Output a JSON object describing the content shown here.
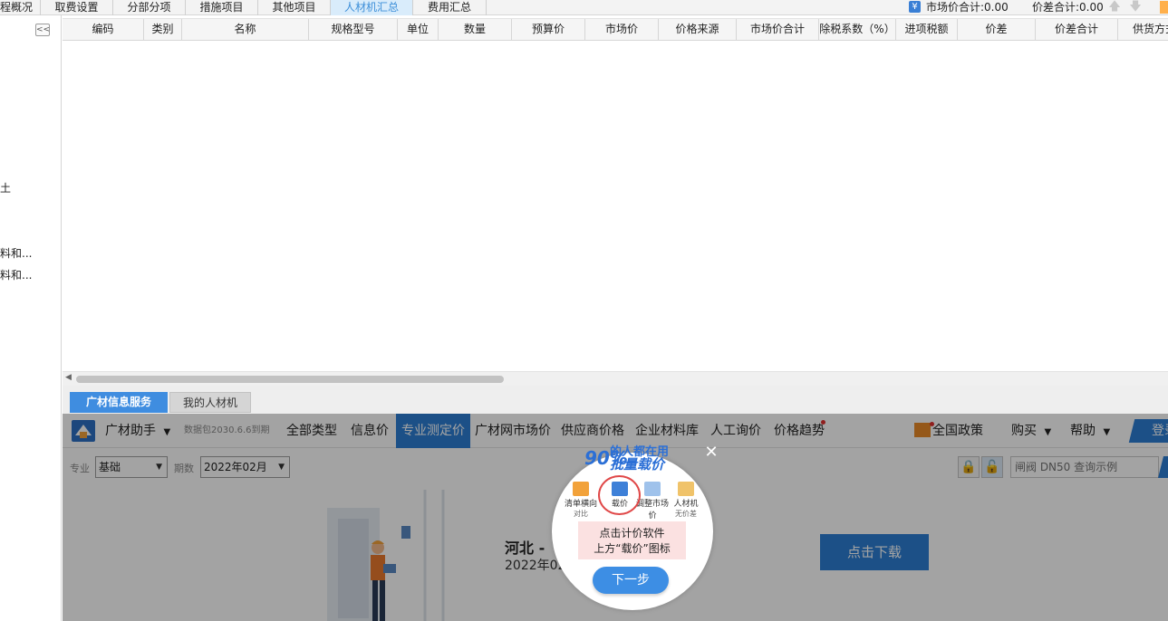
{
  "top_tabs": [
    {
      "label": "程概况"
    },
    {
      "label": "取费设置"
    },
    {
      "label": "分部分项"
    },
    {
      "label": "措施项目"
    },
    {
      "label": "其他项目"
    },
    {
      "label": "人材机汇总"
    },
    {
      "label": "费用汇总"
    }
  ],
  "summary": {
    "market_total": "市场价合计:0.00",
    "diff_total": "价差合计:0.00",
    "yen_icon": "¥"
  },
  "sidebar": {
    "collapse_glyph": "<<",
    "items": [
      "土",
      "料和...",
      "料和..."
    ]
  },
  "table": {
    "columns": [
      "编码",
      "类别",
      "名称",
      "规格型号",
      "单位",
      "数量",
      "预算价",
      "市场价",
      "价格来源",
      "市场价合计",
      "除税系数（%）",
      "进项税额",
      "价差",
      "价差合计",
      "供货方式"
    ]
  },
  "bottom_tabs": {
    "service": "广材信息服务",
    "mine": "我的人材机"
  },
  "gc": {
    "assistant": "广材助手",
    "pkg": "数据包2030.6.6到期",
    "nav": [
      "全部类型",
      "信息价",
      "专业测定价",
      "广材网市场价",
      "供应商价格",
      "企业材料库",
      "人工询价",
      "价格趋势"
    ],
    "active_nav": "专业测定价",
    "policy": "全国政策",
    "buy": "购买",
    "help": "帮助",
    "login": "登录"
  },
  "filters": {
    "major_label": "专业",
    "major_value": "基础",
    "period_label": "期数",
    "period_value": "2022年02月",
    "search_placeholder": "闸阀 DN50 查询示例"
  },
  "promo": {
    "title": "河北 -",
    "date": "2022年02",
    "download": "点击下载"
  },
  "guide": {
    "head_num": "90%",
    "head_top": "的人都在用",
    "head_bottom": "批量载价",
    "tools": [
      {
        "label": "清单横向",
        "sub": "对比"
      },
      {
        "label": "载价",
        "sub": ""
      },
      {
        "label": "调整市场价",
        "sub": "系数"
      },
      {
        "label": "人材机",
        "sub": "无价差"
      }
    ],
    "hint_line1": "点击计价软件",
    "hint_line2": "上方“载价”图标",
    "next": "下一步",
    "close": "✕"
  }
}
